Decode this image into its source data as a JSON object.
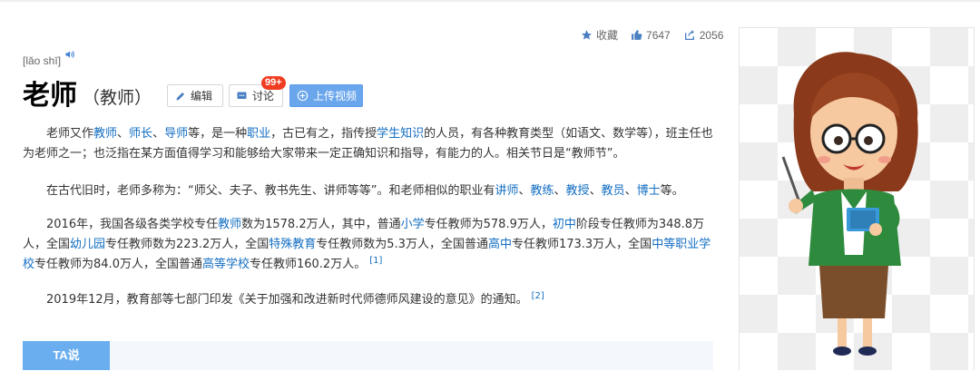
{
  "stats": {
    "collect_label": "收藏",
    "like_count": "7647",
    "share_count": "2056"
  },
  "entry": {
    "pinyin": "[lǎo shī]",
    "title": "老师",
    "subtitle": "（教师）"
  },
  "actions": {
    "edit_label": "编辑",
    "discuss_label": "讨论",
    "discuss_badge": "99+",
    "upload_label": "上传视频"
  },
  "paragraphs": [
    {
      "segments": [
        {
          "t": "老师又作"
        },
        {
          "t": "教师",
          "link": true
        },
        {
          "t": "、"
        },
        {
          "t": "师长",
          "link": true
        },
        {
          "t": "、"
        },
        {
          "t": "导师",
          "link": true
        },
        {
          "t": "等，是一种"
        },
        {
          "t": "职业",
          "link": true
        },
        {
          "t": "，古已有之，指传授"
        },
        {
          "t": "学生",
          "link": true
        },
        {
          "t": "知识",
          "link": true
        },
        {
          "t": "的人员，有各种教育类型（如语文、数学等），班主任也为老师之一；也泛指在某方面值得学习和能够给大家带来一定正确知识和指导，有能力的人。相关节日是“教师节”。"
        }
      ]
    },
    {
      "segments": [
        {
          "t": "在古代旧时，老师多称为：“师父、夫子、教书先生、讲师等等”。和老师相似的职业有"
        },
        {
          "t": "讲师",
          "link": true
        },
        {
          "t": "、"
        },
        {
          "t": "教练",
          "link": true
        },
        {
          "t": "、"
        },
        {
          "t": "教授",
          "link": true
        },
        {
          "t": "、"
        },
        {
          "t": "教员",
          "link": true
        },
        {
          "t": "、"
        },
        {
          "t": "博士",
          "link": true
        },
        {
          "t": "等。"
        }
      ]
    },
    {
      "segments": [
        {
          "t": "2016年，我国各级各类学校专任"
        },
        {
          "t": "教师",
          "link": true
        },
        {
          "t": "数为1578.2万人，其中，普通"
        },
        {
          "t": "小学",
          "link": true
        },
        {
          "t": "专任教师为578.9万人，"
        },
        {
          "t": "初中",
          "link": true
        },
        {
          "t": "阶段专任教师为348.8万人，全国"
        },
        {
          "t": "幼儿园",
          "link": true
        },
        {
          "t": "专任教师数为223.2万人，全国"
        },
        {
          "t": "特殊教育",
          "link": true
        },
        {
          "t": "专任教师数为5.3万人，全国普通"
        },
        {
          "t": "高中",
          "link": true
        },
        {
          "t": "专任教师173.3万人，全国"
        },
        {
          "t": "中等职业学校",
          "link": true
        },
        {
          "t": "专任教师为84.0万人，全国普通"
        },
        {
          "t": "高等学校",
          "link": true
        },
        {
          "t": "专任教师160.2万人。"
        },
        {
          "t": "[1]",
          "ref": true
        }
      ]
    },
    {
      "segments": [
        {
          "t": "2019年12月，教育部等七部门印发《关于加强和改进新时代师德师风建设的意见》的通知。"
        },
        {
          "t": "[2]",
          "ref": true
        }
      ]
    }
  ],
  "ta_section": {
    "tab_label": "TA说"
  },
  "colors": {
    "link": "#136ec2",
    "upload_button": "#6aa6ec",
    "badge": "#f03c21",
    "ta_tab": "#6aaef0"
  },
  "icons": [
    "star-icon",
    "thumbs-up-icon",
    "share-icon",
    "speaker-icon",
    "pencil-icon",
    "chat-icon",
    "plus-circle-icon"
  ]
}
